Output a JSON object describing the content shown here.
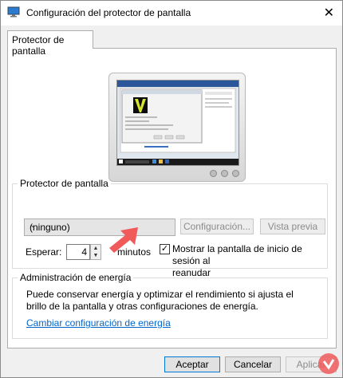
{
  "window": {
    "title": "Configuración del protector de pantalla",
    "close_label": "✕"
  },
  "tab": {
    "label": "Protector de pantalla"
  },
  "screensaver": {
    "group_label": "Protector de pantalla",
    "selected": "(ninguno)",
    "settings_button": "Configuración...",
    "preview_button": "Vista previa",
    "wait_label": "Esperar:",
    "wait_value": "4",
    "minutes_label": "minutos",
    "logon_checkbox_checked": true,
    "logon_label_line1": "Mostrar la pantalla de inicio de sesión al",
    "logon_label_line2": "reanudar"
  },
  "power": {
    "group_label": "Administración de energía",
    "description_line1": "Puede conservar energía y optimizar el rendimiento si ajusta el",
    "description_line2": "brillo de la pantalla y otras configuraciones de energía.",
    "link_label": "Cambiar configuración de energía"
  },
  "footer": {
    "accept": "Aceptar",
    "cancel": "Cancelar",
    "apply": "Aplicar"
  },
  "colors": {
    "accent": "#0078d7",
    "link": "#0066cc",
    "arrow": "#f05a5a"
  }
}
